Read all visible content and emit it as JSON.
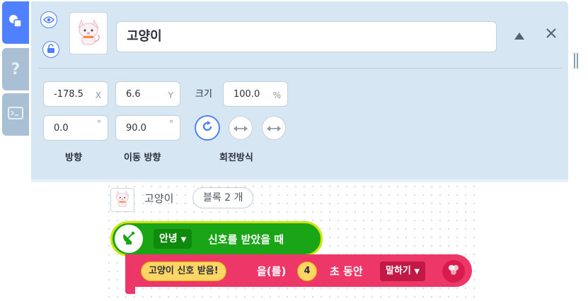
{
  "sidebar": {
    "tabs": [
      {
        "icon": "shapes-icon",
        "active": true
      },
      {
        "label": "?",
        "icon": "help-icon",
        "active": false
      },
      {
        "icon": "console-icon",
        "active": false
      }
    ]
  },
  "object": {
    "name": "고양이",
    "x": "-178.5",
    "x_unit": "X",
    "y": "6.6",
    "y_unit": "Y",
    "size_label": "크기",
    "size": "100.0",
    "size_unit": "%",
    "direction": "0.0",
    "direction_unit": "°",
    "move_direction": "90.0",
    "move_direction_unit": "°",
    "direction_label": "방향",
    "move_direction_label": "이동 방향",
    "rotation_label": "회전방식"
  },
  "blocks": {
    "object_name": "고양이",
    "count_label": "블록 2 개",
    "trigger": {
      "signal": "안녕",
      "text": "신호를 받았을 때"
    },
    "action": {
      "message": "고양이 신호 받음!",
      "particle": "을(를)",
      "seconds": "4",
      "suffix": "초 동안",
      "mode": "말하기"
    }
  },
  "colors": {
    "accent": "#4f80ff",
    "panel": "#d7e6f3",
    "trigger_green": "#1aa516",
    "trigger_border": "#cbe700",
    "action_red": "#ee3769"
  }
}
